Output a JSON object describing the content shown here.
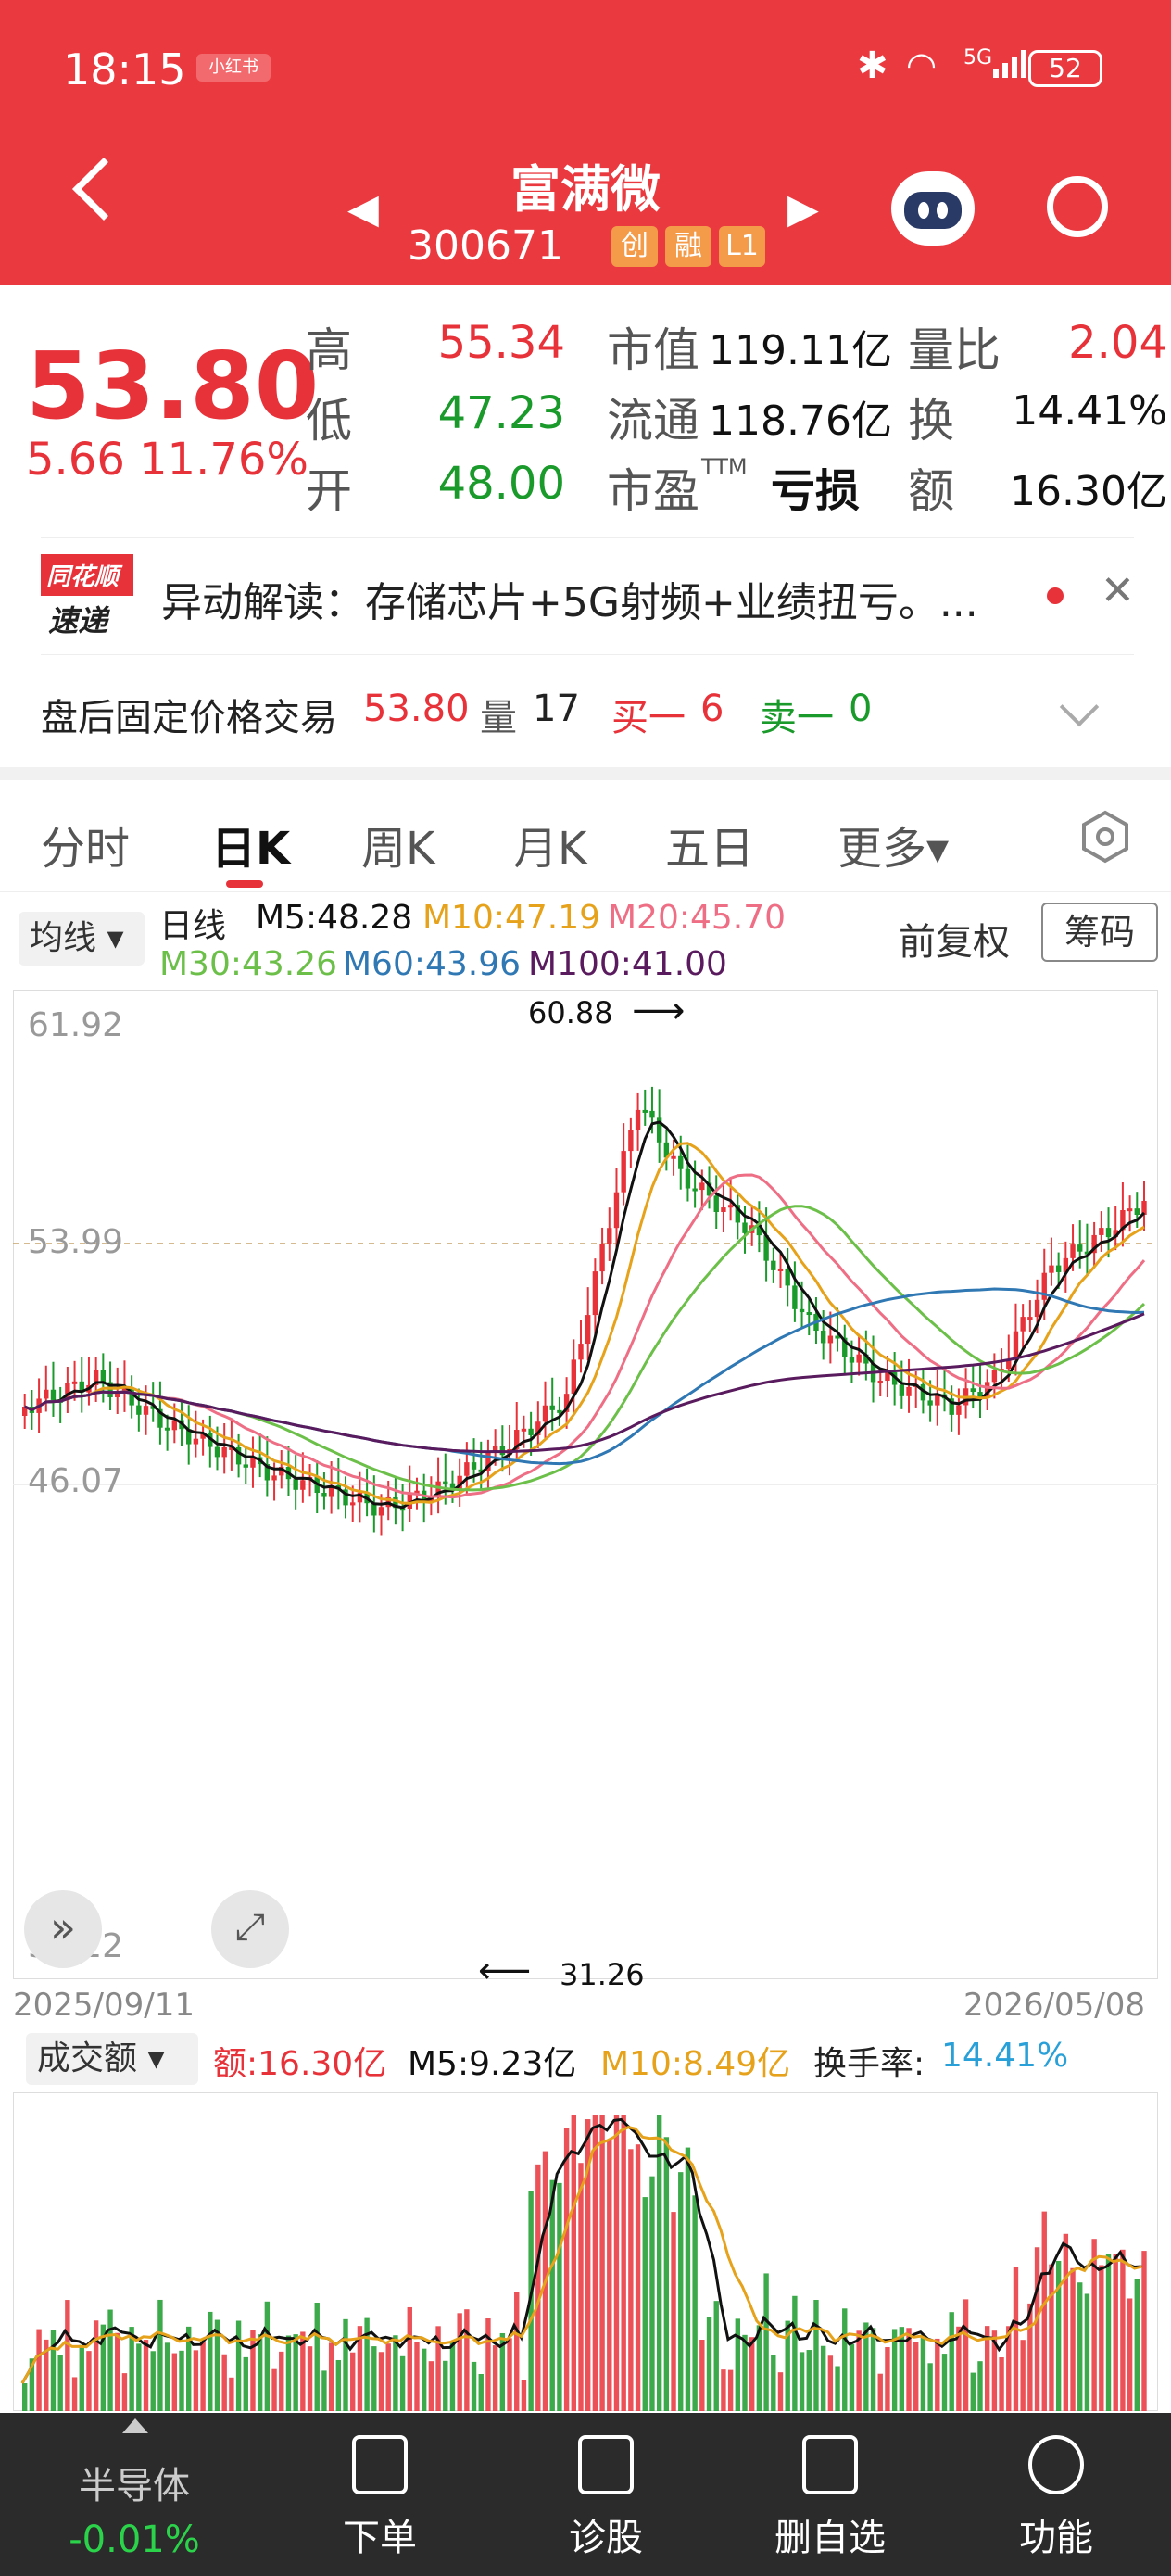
{
  "status": {
    "time": "18:15",
    "app_badge": "小红书",
    "network": "5G",
    "battery": "52"
  },
  "header": {
    "stock_name": "富满微",
    "code": "300671",
    "tags": [
      "创",
      "融",
      "L1"
    ]
  },
  "quote": {
    "price": "53.80",
    "change": "5.66",
    "change_pct": "11.76%",
    "high_label": "高",
    "high": "55.34",
    "low_label": "低",
    "low": "47.23",
    "open_label": "开",
    "open": "48.00",
    "mcap_label": "市值",
    "mcap": "119.11亿",
    "float_label": "流通",
    "float": "118.76亿",
    "pe_label": "市盈",
    "pe_sup": "TTM",
    "pe": "亏损",
    "vr_label": "量比",
    "vr": "2.04",
    "turn_label": "换",
    "turn": "14.41%",
    "amt_label": "额",
    "amt": "16.30亿"
  },
  "news": {
    "logo_top": "同花顺",
    "logo_bottom": "速递",
    "text": "异动解读：存储芯片+5G射频+业绩扭亏。..."
  },
  "after_hours": {
    "label": "盘后固定价格交易",
    "price": "53.80",
    "vol_label": "量",
    "vol": "17",
    "buy_label": "买一",
    "buy": "6",
    "sell_label": "卖一",
    "sell": "0"
  },
  "tabs": [
    "分时",
    "日K",
    "周K",
    "月K",
    "五日",
    "更多▾"
  ],
  "ma_legend": {
    "selector": "均线",
    "line_type": "日线",
    "m5": "M5:48.28",
    "m10": "M10:47.19",
    "m20": "M20:45.70",
    "m30": "M30:43.26",
    "m60": "M60:43.96",
    "m100": "M100:41.00",
    "adjust": "前复权",
    "chip": "筹码"
  },
  "price_axis": [
    "61.92",
    "53.99",
    "46.07",
    "38.22"
  ],
  "annotations": {
    "high": "60.88",
    "low": "31.26"
  },
  "dates": {
    "start": "2025/09/11",
    "end": "2026/05/08"
  },
  "vol_legend": {
    "selector": "成交额",
    "amt": "额:16.30亿",
    "m5": "M5:9.23亿",
    "m10": "M10:8.49亿",
    "turn_label": "换手率:",
    "turn": "14.41%"
  },
  "colors": {
    "red": "#e8323a",
    "green": "#1a9a2a",
    "m5": "#111111",
    "m10": "#e6a21a",
    "m20": "#ee6f85",
    "m30": "#6cc04a",
    "m60": "#2f78b4",
    "m100": "#5a1a5e"
  },
  "bottom_bar": {
    "sector": "半导体",
    "sector_chg": "-0.01%",
    "items": [
      "下单",
      "诊股",
      "删自选",
      "功能"
    ]
  },
  "chart_data": {
    "type": "candlestick",
    "x_range": [
      "2025/09/11",
      "2026/05/08"
    ],
    "y_range": [
      38.22,
      61.92
    ],
    "high_marker": 60.88,
    "low_marker": 31.26,
    "last_close": 53.8
  }
}
